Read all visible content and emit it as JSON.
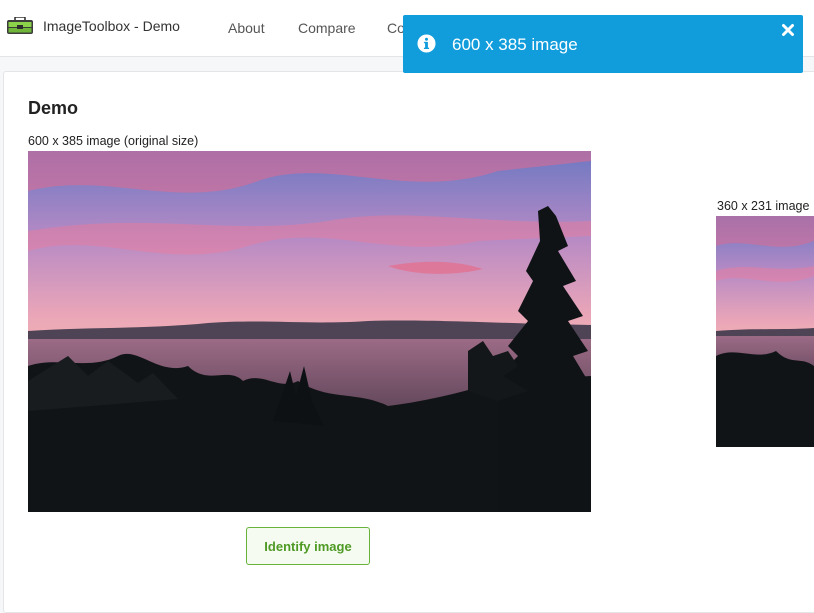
{
  "navbar": {
    "brand": "ImageToolbox - Demo",
    "brand_icon": "toolbox-icon",
    "links": [
      "About",
      "Compare",
      "Co"
    ]
  },
  "main": {
    "title": "Demo",
    "original": {
      "caption": "600 x 385 image (original size)"
    },
    "resized": {
      "caption": "360 x 231 image"
    },
    "identify_button": "Identify image"
  },
  "toast": {
    "message": "600 x 385 image",
    "icon": "info-icon",
    "close_icon": "close-icon",
    "color": "#119ddc"
  }
}
